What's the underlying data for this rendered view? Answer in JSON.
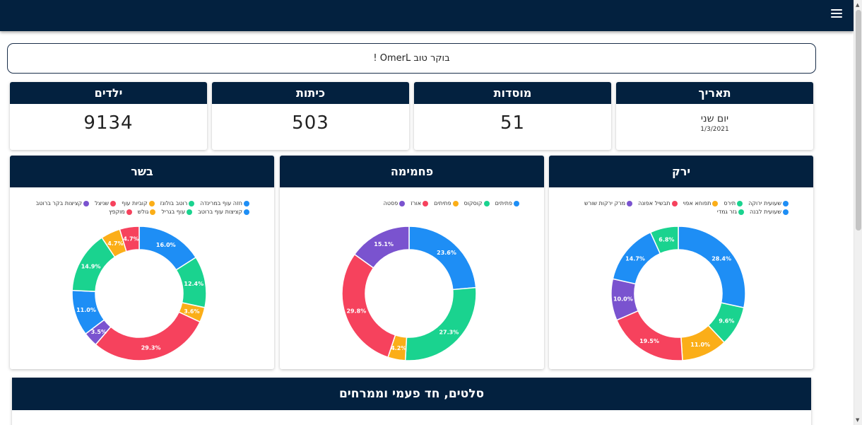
{
  "header": {
    "menu_icon": "hamburger-menu-icon"
  },
  "greeting": {
    "text": "בוקר טוב OmerL !"
  },
  "stats": {
    "date": {
      "title": "תאריך",
      "day": "יום שני",
      "date": "1/3/2021"
    },
    "institutions": {
      "title": "מוסדות",
      "value": "51"
    },
    "classes": {
      "title": "כיתות",
      "value": "503"
    },
    "children": {
      "title": "ילדים",
      "value": "9134"
    }
  },
  "colors": {
    "blue": "#1e8ef5",
    "green": "#1ad38f",
    "yellow": "#fbae18",
    "red": "#f6425d",
    "purple": "#7a53cf",
    "navy": "#03213f"
  },
  "charts": [
    {
      "title": "ירק",
      "legend": [
        {
          "label": "שעועית ירוקה",
          "color": "#1e8ef5"
        },
        {
          "label": "תירס",
          "color": "#1ad38f"
        },
        {
          "label": "תפוחא אפוי",
          "color": "#fbae18"
        },
        {
          "label": "תבשיל אפונה",
          "color": "#f6425d"
        },
        {
          "label": "מרק ירקות שורש",
          "color": "#7a53cf"
        },
        {
          "label": "שעועית לבנה",
          "color": "#1e8ef5"
        },
        {
          "label": "גזר גמדי",
          "color": "#1ad38f"
        }
      ],
      "slices": [
        {
          "value": 28.4,
          "label": "28.4%",
          "color": "#1e8ef5"
        },
        {
          "value": 9.6,
          "label": "9.6%",
          "color": "#1ad38f"
        },
        {
          "value": 11.0,
          "label": "11.0%",
          "color": "#fbae18"
        },
        {
          "value": 19.5,
          "label": "19.5%",
          "color": "#f6425d"
        },
        {
          "value": 10.0,
          "label": "10.0%",
          "color": "#7a53cf"
        },
        {
          "value": 14.7,
          "label": "14.7%",
          "color": "#1e8ef5"
        },
        {
          "value": 6.8,
          "label": "6.8%",
          "color": "#1ad38f"
        }
      ]
    },
    {
      "title": "פחמימה",
      "legend": [
        {
          "label": "פתיתים",
          "color": "#1e8ef5"
        },
        {
          "label": "קוסקוס",
          "color": "#1ad38f"
        },
        {
          "label": "פתיתים",
          "color": "#fbae18"
        },
        {
          "label": "אורז",
          "color": "#f6425d"
        },
        {
          "label": "פסטה",
          "color": "#7a53cf"
        }
      ],
      "slices": [
        {
          "value": 23.6,
          "label": "23.6%",
          "color": "#1e8ef5"
        },
        {
          "value": 27.3,
          "label": "27.3%",
          "color": "#1ad38f"
        },
        {
          "value": 4.2,
          "label": "4.2%",
          "color": "#fbae18"
        },
        {
          "value": 29.8,
          "label": "29.8%",
          "color": "#f6425d"
        },
        {
          "value": 15.1,
          "label": "15.1%",
          "color": "#7a53cf"
        }
      ]
    },
    {
      "title": "בשר",
      "legend": [
        {
          "label": "חזה עוף במרינדה",
          "color": "#1e8ef5"
        },
        {
          "label": "רוטב בולונז",
          "color": "#1ad38f"
        },
        {
          "label": "קוביות עוף",
          "color": "#fbae18"
        },
        {
          "label": "שניצל",
          "color": "#f6425d"
        },
        {
          "label": "קציצות בקר ברוטב",
          "color": "#7a53cf"
        },
        {
          "label": "קציצות עוף ברוטב",
          "color": "#1e8ef5"
        },
        {
          "label": "עוף בגריל",
          "color": "#1ad38f"
        },
        {
          "label": "גולש",
          "color": "#fbae18"
        },
        {
          "label": "מוקפץ",
          "color": "#f6425d"
        }
      ],
      "slices": [
        {
          "value": 16.0,
          "label": "16.0%",
          "color": "#1e8ef5"
        },
        {
          "value": 12.4,
          "label": "12.4%",
          "color": "#1ad38f"
        },
        {
          "value": 3.6,
          "label": "3.6%",
          "color": "#fbae18"
        },
        {
          "value": 29.3,
          "label": "29.3%",
          "color": "#f6425d"
        },
        {
          "value": 3.5,
          "label": "3.5%",
          "color": "#7a53cf"
        },
        {
          "value": 11.0,
          "label": "11.0%",
          "color": "#1e8ef5"
        },
        {
          "value": 14.9,
          "label": "14.9%",
          "color": "#1ad38f"
        },
        {
          "value": 4.7,
          "label": "4.7%",
          "color": "#fbae18"
        },
        {
          "value": 4.7,
          "label": "4.7%",
          "color": "#f6425d"
        }
      ]
    }
  ],
  "chart_data": [
    {
      "type": "pie",
      "title": "ירק",
      "categories": [
        "שעועית ירוקה",
        "תירס",
        "תפוחא אפוי",
        "תבשיל אפונה",
        "מרק ירקות שורש",
        "שעועית לבנה",
        "גזר גמדי"
      ],
      "values": [
        28.4,
        9.6,
        11.0,
        19.5,
        10.0,
        14.7,
        6.8
      ],
      "legend": "top"
    },
    {
      "type": "pie",
      "title": "פחמימה",
      "categories": [
        "פתיתים",
        "קוסקוס",
        "פתיתים",
        "אורז",
        "פסטה"
      ],
      "values": [
        23.6,
        27.3,
        4.2,
        29.8,
        15.1
      ],
      "legend": "top"
    },
    {
      "type": "pie",
      "title": "בשר",
      "categories": [
        "חזה עוף במרינדה",
        "רוטב בולונז",
        "קוביות עוף",
        "שניצל",
        "קציצות בקר ברוטב",
        "קציצות עוף ברוטב",
        "עוף בגריל",
        "גולש",
        "מוקפץ"
      ],
      "values": [
        16.0,
        12.4,
        3.6,
        29.3,
        3.5,
        11.0,
        14.9,
        4.7,
        4.7
      ],
      "legend": "top"
    }
  ],
  "bottom_section": {
    "title": "סלטים, חד פעמי וממרחים"
  }
}
